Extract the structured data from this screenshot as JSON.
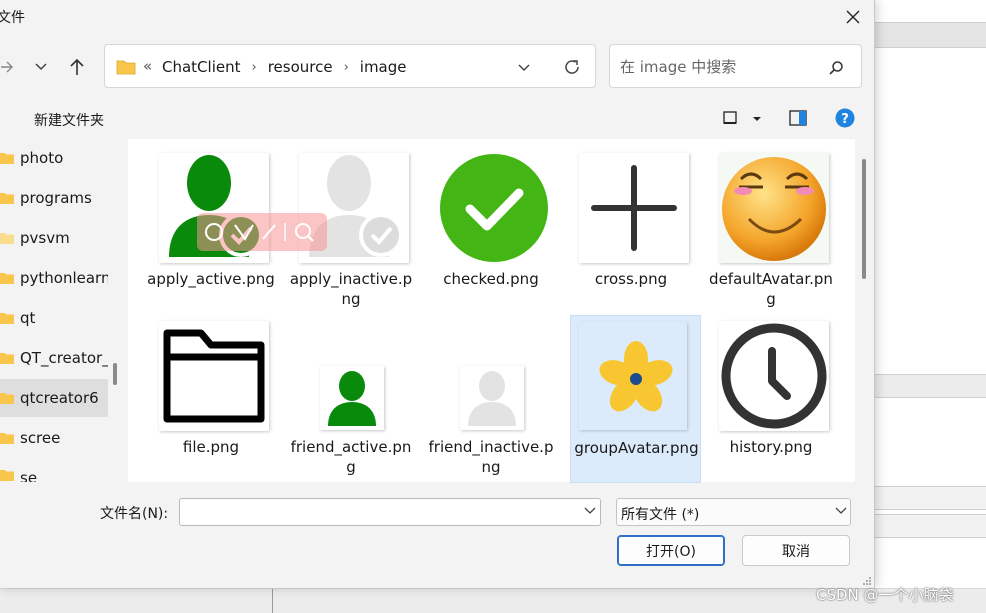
{
  "window": {
    "title": "文件"
  },
  "address": {
    "overflow": "«",
    "crumbs": [
      "ChatClient",
      "resource",
      "image"
    ]
  },
  "search": {
    "placeholder": "在 image 中搜索"
  },
  "toolbar": {
    "new_folder": "新建文件夹"
  },
  "sidebar": {
    "items": [
      {
        "label": "photo",
        "selected": false
      },
      {
        "label": "programs",
        "selected": false
      },
      {
        "label": "pvsvm",
        "selected": false
      },
      {
        "label": "pythonlearn",
        "selected": false
      },
      {
        "label": "qt",
        "selected": false
      },
      {
        "label": "QT_creator_",
        "selected": false
      },
      {
        "label": "qtcreator6",
        "selected": true
      },
      {
        "label": "scree",
        "selected": false
      },
      {
        "label": "se",
        "selected": false
      }
    ]
  },
  "files": [
    {
      "label": "apply_active.png",
      "icon": "green-user-check-icon"
    },
    {
      "label": "apply_inactive.png",
      "icon": "gray-user-check-icon"
    },
    {
      "label": "checked.png",
      "icon": "green-check-circle-icon"
    },
    {
      "label": "cross.png",
      "icon": "plus-cross-icon"
    },
    {
      "label": "defaultAvatar.png",
      "icon": "smiley-face-icon"
    },
    {
      "label": "file.png",
      "icon": "folder-outline-icon"
    },
    {
      "label": "friend_active.png",
      "icon": "green-user-icon"
    },
    {
      "label": "friend_inactive.png",
      "icon": "gray-user-icon"
    },
    {
      "label": "groupAvatar.png",
      "icon": "flower-icon",
      "selected": true
    },
    {
      "label": "history.png",
      "icon": "clock-icon"
    }
  ],
  "filename": {
    "label": "文件名(N):",
    "value": ""
  },
  "filter": {
    "value": "所有文件 (*)"
  },
  "buttons": {
    "open": "打开(O)",
    "cancel": "取消"
  },
  "watermark": {
    "text": "CSDN @一个小脑袋"
  },
  "colors": {
    "accent": "#2f6fc7",
    "selected_tile": "#dcebfb",
    "folder": "#f7c64b",
    "green": "#0a8a0a",
    "check_green": "#4cbb17",
    "help_blue": "#1f84e0"
  }
}
